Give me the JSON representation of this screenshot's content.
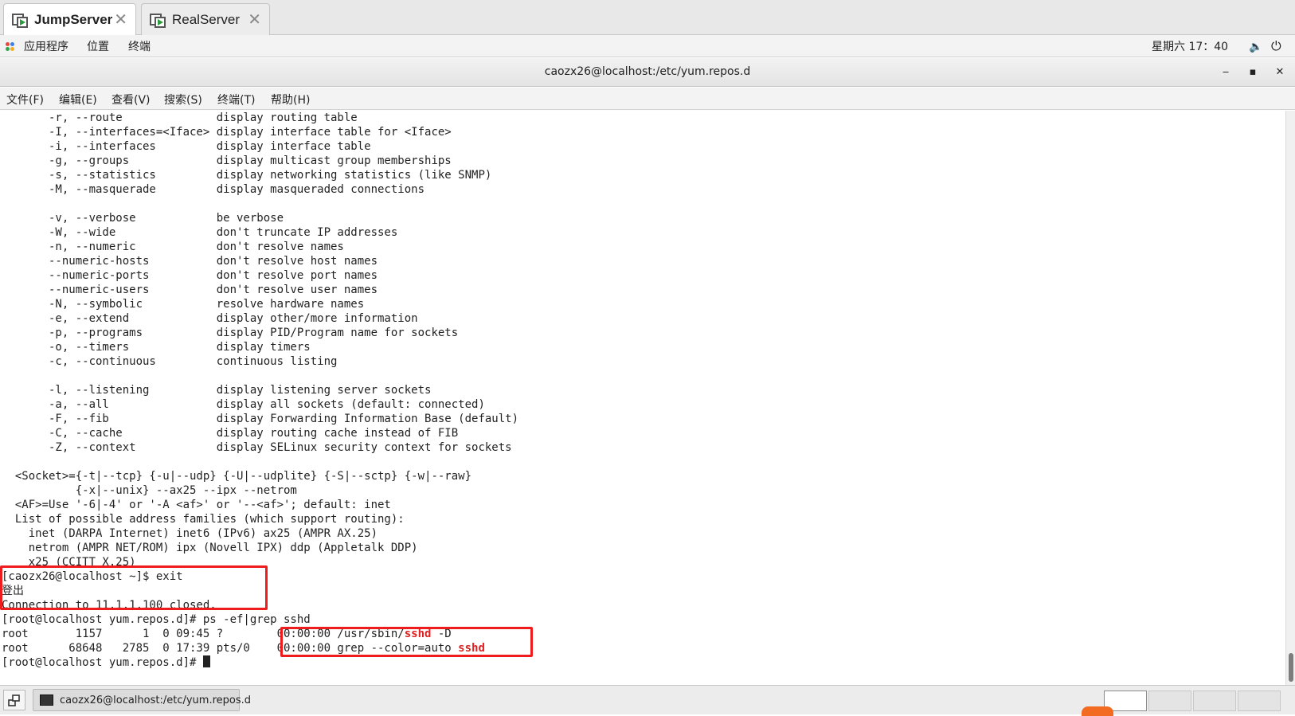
{
  "vm_tabs": [
    {
      "label": "JumpServer",
      "close": "✕"
    },
    {
      "label": "RealServer",
      "close": "✕"
    }
  ],
  "gnome": {
    "apps": "应用程序",
    "places": "位置",
    "terminal": "终端",
    "clock": "星期六 17：40",
    "volume_icon": "🔈",
    "power_icon": "⏻"
  },
  "window": {
    "title": "caozx26@localhost:/etc/yum.repos.d",
    "minimize": "‒",
    "maximize": "▪",
    "close": "✕"
  },
  "menu": [
    "文件(F)",
    "编辑(E)",
    "查看(V)",
    "搜索(S)",
    "终端(T)",
    "帮助(H)"
  ],
  "terminal_lines": [
    "       -r, --route              display routing table",
    "       -I, --interfaces=<Iface> display interface table for <Iface>",
    "       -i, --interfaces         display interface table",
    "       -g, --groups             display multicast group memberships",
    "       -s, --statistics         display networking statistics (like SNMP)",
    "       -M, --masquerade         display masqueraded connections",
    "",
    "       -v, --verbose            be verbose",
    "       -W, --wide               don't truncate IP addresses",
    "       -n, --numeric            don't resolve names",
    "       --numeric-hosts          don't resolve host names",
    "       --numeric-ports          don't resolve port names",
    "       --numeric-users          don't resolve user names",
    "       -N, --symbolic           resolve hardware names",
    "       -e, --extend             display other/more information",
    "       -p, --programs           display PID/Program name for sockets",
    "       -o, --timers             display timers",
    "       -c, --continuous         continuous listing",
    "",
    "       -l, --listening          display listening server sockets",
    "       -a, --all                display all sockets (default: connected)",
    "       -F, --fib                display Forwarding Information Base (default)",
    "       -C, --cache              display routing cache instead of FIB",
    "       -Z, --context            display SELinux security context for sockets",
    "",
    "  <Socket>={-t|--tcp} {-u|--udp} {-U|--udplite} {-S|--sctp} {-w|--raw}",
    "           {-x|--unix} --ax25 --ipx --netrom",
    "  <AF>=Use '-6|-4' or '-A <af>' or '--<af>'; default: inet",
    "  List of possible address families (which support routing):",
    "    inet (DARPA Internet) inet6 (IPv6) ax25 (AMPR AX.25)",
    "    netrom (AMPR NET/ROM) ipx (Novell IPX) ddp (Appletalk DDP)",
    "    x25 (CCITT X.25)",
    "[caozx26@localhost ~]$ exit",
    "登出",
    "Connection to 11.1.1.100 closed.",
    "[root@localhost yum.repos.d]# ps -ef|grep sshd"
  ],
  "ps_rows": [
    {
      "prefix": "root       1157      1  0 09:45 ?        00:00:00 /usr/sbin/",
      "match": "sshd",
      "suffix": " -D"
    },
    {
      "prefix": "root      68648   2785  0 17:39 pts/0    00:00:00 grep --color=auto ",
      "match": "sshd",
      "suffix": ""
    }
  ],
  "prompt_line": "[root@localhost yum.repos.d]# ",
  "taskbar": {
    "task_label": "caozx26@localhost:/etc/yum.repos.d"
  },
  "colors": {
    "highlight_box": "#ee1c1c",
    "match_text": "#e02020"
  }
}
